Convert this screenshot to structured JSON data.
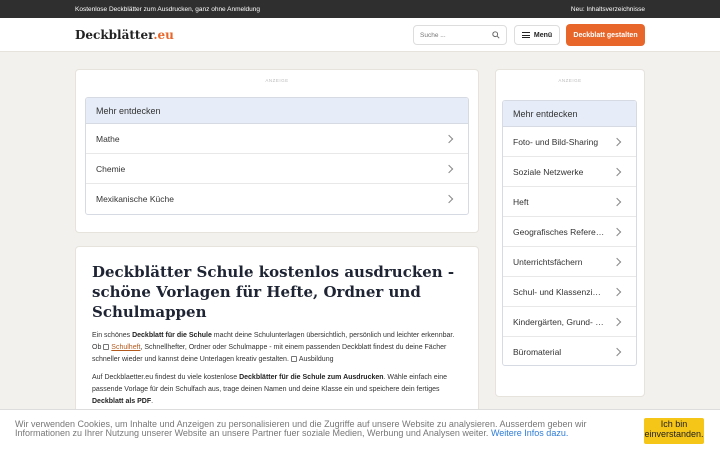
{
  "topbar": {
    "left_text": "Kostenlose Deckblätter zum Ausdrucken, ganz ohne Anmeldung",
    "right_text": "Neu: Inhaltsverzeichnisse"
  },
  "header": {
    "logo_main": "Deckblätter",
    "logo_tld": ".eu",
    "search_placeholder": "Suche ...",
    "menu_label": "Menü",
    "cta_label": "Deckblatt gestalten"
  },
  "ads": {
    "label": "ANZEIGE"
  },
  "discover_main": {
    "heading": "Mehr entdecken",
    "items": [
      "Mathe",
      "Chemie",
      "Mexikanische Küche"
    ]
  },
  "discover_side": {
    "heading": "Mehr entdecken",
    "items": [
      "Foto- und Bild-Sharing",
      "Soziale Netzwerke",
      "Heft",
      "Geografisches Referenzmaterial",
      "Unterrichtsfächern",
      "Schul- und Klassenzimmer",
      "Kindergärten, Grund- und",
      "Büromaterial"
    ]
  },
  "article": {
    "title": "Deckblätter Schule kostenlos ausdrucken - schöne Vorlagen für Hefte, Ordner und Schulmappen",
    "p1_a": "Ein schönes ",
    "p1_b": "Deckblatt für die Schule",
    "p1_c": " macht deine Schulunterlagen übersichtlich, persönlich und leichter erkennbar. Ob ",
    "p1_link": "Schulheft",
    "p1_d": ", Schnellhefter, Ordner oder Schulmappe - mit einem passenden Deckblatt findest du deine Fächer schneller wieder und kannst deine Unterlagen kreativ gestalten. ",
    "p1_tag": "Ausbildung",
    "p2_a": "Auf Deckblaetter.eu findest du viele kostenlose ",
    "p2_b": "Deckblätter für die Schule zum Ausdrucken",
    "p2_c": ". Wähle einfach eine passende Vorlage für dein Schulfach aus, trage deinen Namen und deine Klasse ein und speichere dein fertiges ",
    "p2_d": "Deckblatt als PDF",
    "p2_e": "."
  },
  "cookie": {
    "text": "Wir verwenden Cookies, um Inhalte und Anzeigen zu personalisieren und die Zugriffe auf unsere Website zu analysieren. Ausserdem geben wir Informationen zu Ihrer Nutzung unserer Website an unsere Partner fuer soziale Medien, Werbung und Analysen weiter.",
    "more_link": "Weitere Infos dazu.",
    "accept_label": "Ich bin einverstanden."
  }
}
